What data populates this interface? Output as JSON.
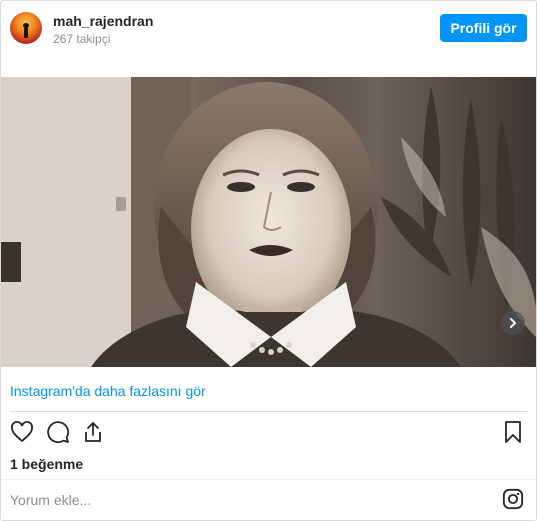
{
  "header": {
    "username": "mah_rajendran",
    "followers": "267 takipçi",
    "profile_button": "Profili gör"
  },
  "post": {
    "image_icon": "photo",
    "more_link": "Instagram'da daha fazlasını gör",
    "likes": "1 beğenme",
    "comment_placeholder": "Yorum ekle..."
  },
  "icons": {
    "like": "heart-icon",
    "comment": "comment-icon",
    "share": "share-icon",
    "save": "bookmark-icon",
    "next": "chevron-right-icon",
    "instagram": "instagram-icon"
  }
}
